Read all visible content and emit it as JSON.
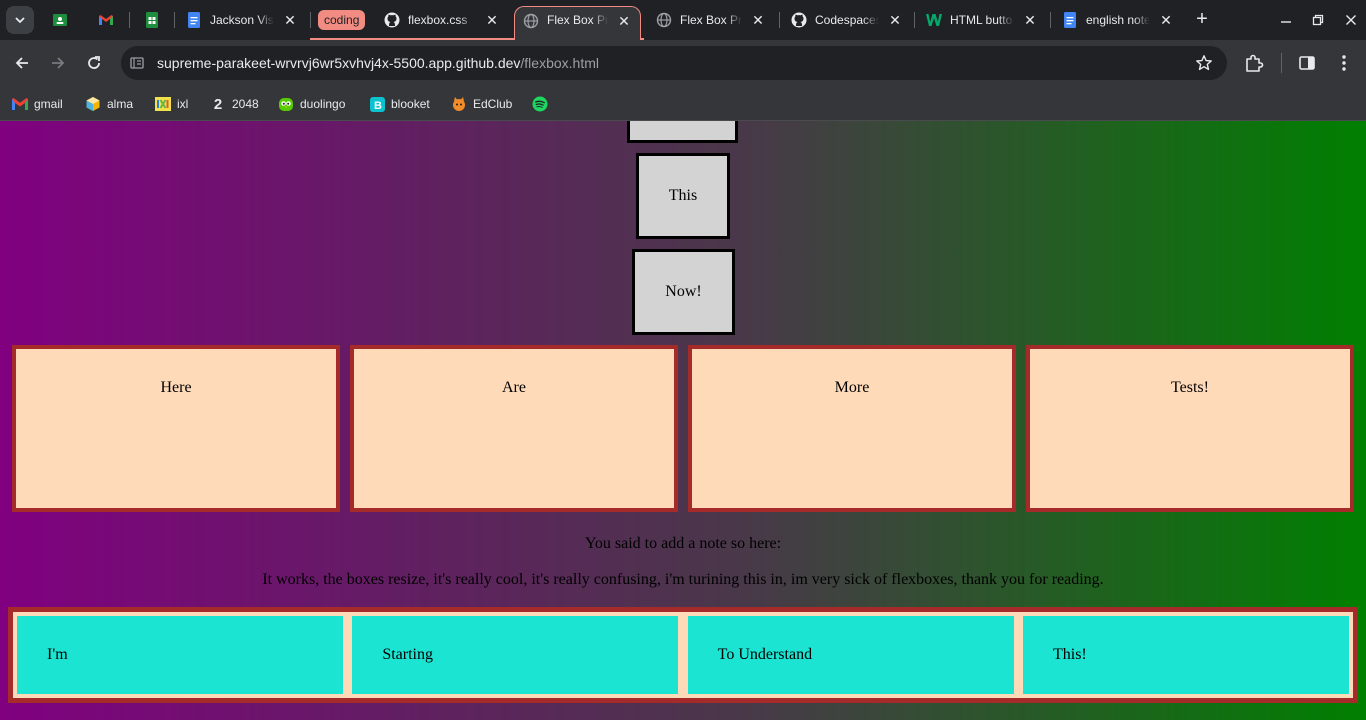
{
  "browser": {
    "tabs": [
      {
        "title": "Jackson Vis",
        "icon": "google-docs-icon"
      },
      {
        "title": "flexbox.css",
        "icon": "github-icon"
      },
      {
        "title": "Flex Box Pra",
        "icon": "globe-icon",
        "active": true
      },
      {
        "title": "Flex Box Pra",
        "icon": "globe-icon"
      },
      {
        "title": "Codespaces",
        "icon": "github-icon"
      },
      {
        "title": "HTML butto",
        "icon": "w3schools-icon"
      },
      {
        "title": "english note",
        "icon": "google-docs-icon"
      }
    ],
    "tab_group_label": "coding",
    "url_host": "supreme-parakeet-wrvrvj6wr5xvhvj4x-5500.app.github.dev",
    "url_path": "/flexbox.html",
    "group_color": "#f28b82"
  },
  "bookmarks": [
    {
      "label": "gmail",
      "icon": "gmail-icon"
    },
    {
      "label": "alma",
      "icon": "alma-icon"
    },
    {
      "label": "ixl",
      "icon": "ixl-icon"
    },
    {
      "label": "2048",
      "icon": "2048-icon"
    },
    {
      "label": "duolingo",
      "icon": "duolingo-icon"
    },
    {
      "label": "blooket",
      "icon": "blooket-icon"
    },
    {
      "label": "EdClub",
      "icon": "edclub-icon"
    },
    {
      "label": "",
      "icon": "spotify-icon"
    }
  ],
  "page": {
    "stack_boxes": [
      "This",
      "Now!"
    ],
    "peach_boxes": [
      "Here",
      "Are",
      "More",
      "Tests!"
    ],
    "note_heading": "You said to add a note so here:",
    "note_text": "It works, the boxes resize, it's really cool, it's really confusing, i'm turining this in, im very sick of flexboxes, thank you for reading.",
    "cyan_boxes": [
      "I'm",
      "Starting",
      "To Understand",
      "This!"
    ],
    "colors": {
      "gradient_start": "#800080",
      "gradient_end": "#008000",
      "peach": "#ffdab9",
      "border_brown": "#a52a2a",
      "cyan": "#1be5d2",
      "gray_box": "#d3d3d3"
    }
  }
}
